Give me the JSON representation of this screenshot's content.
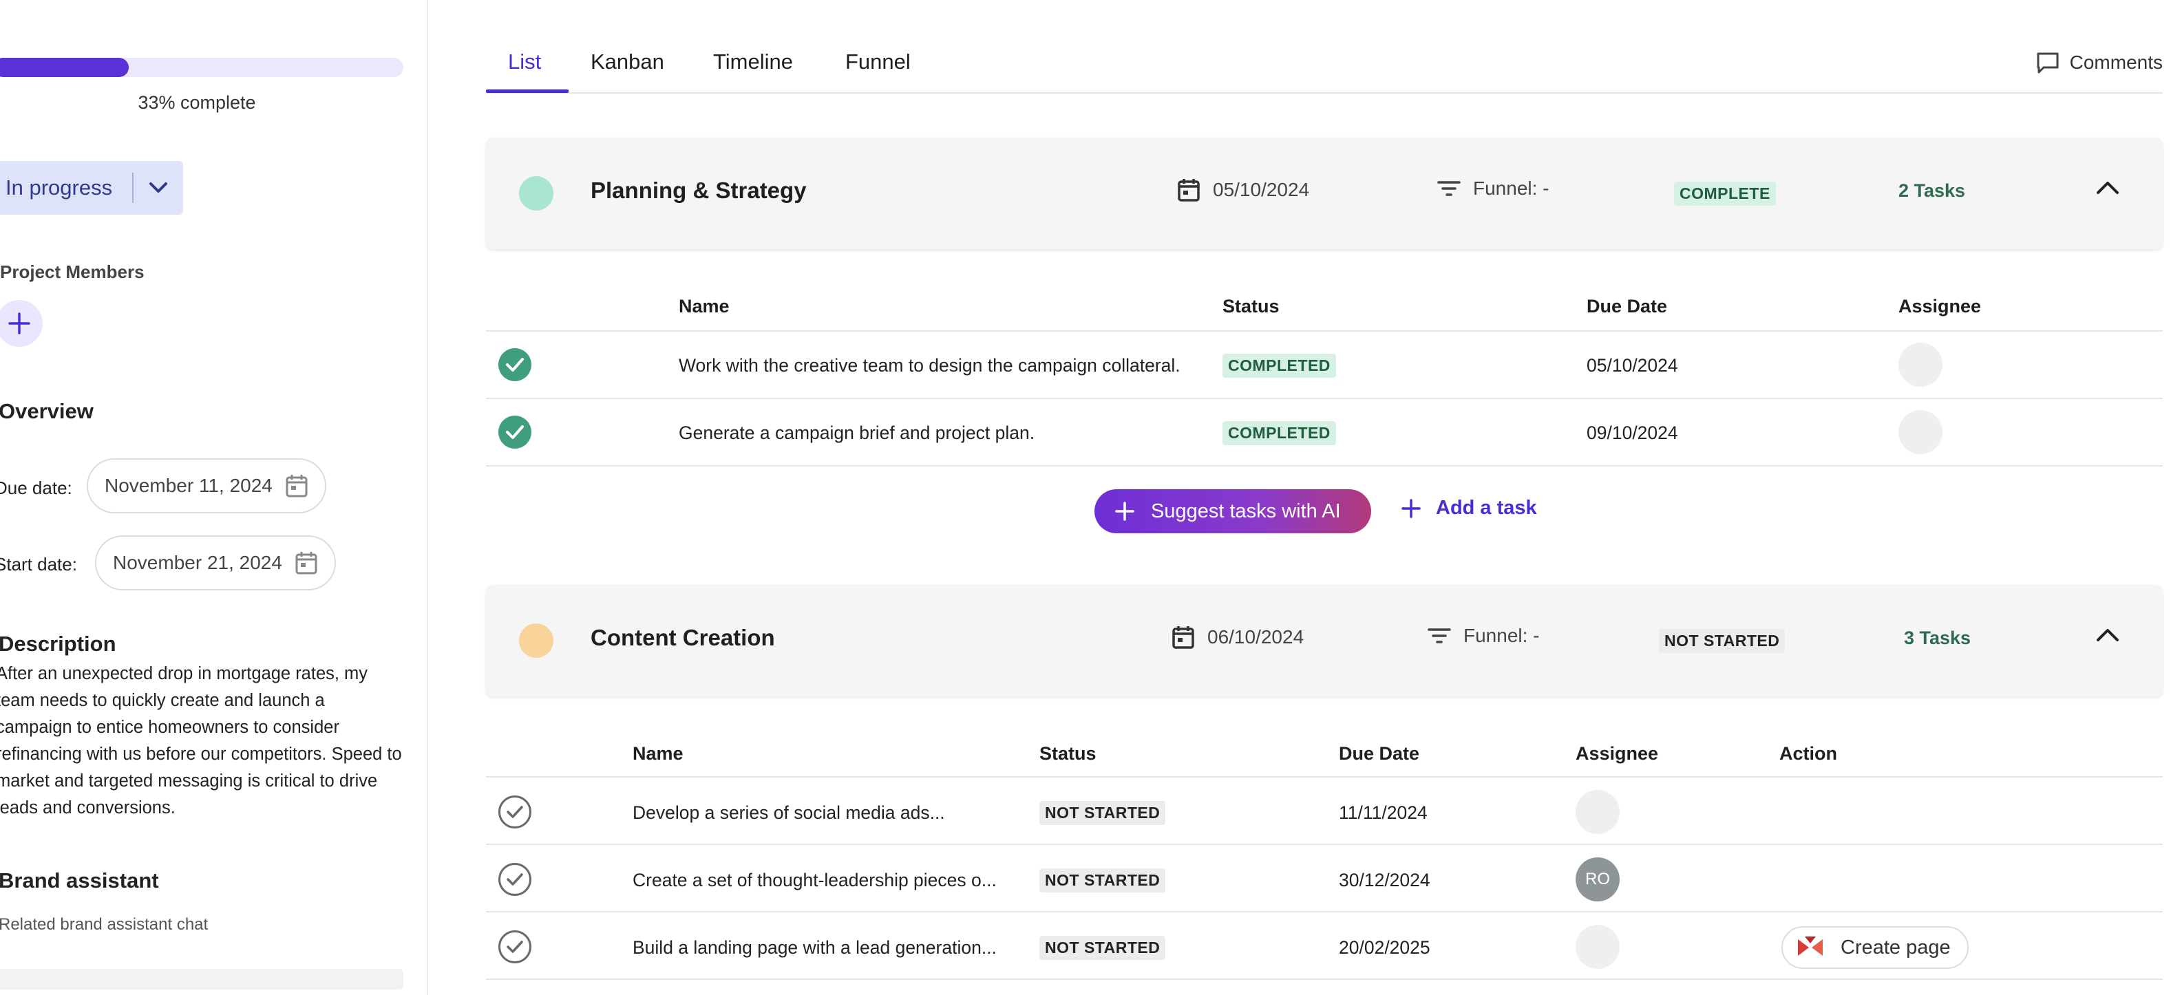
{
  "sidebar": {
    "progress": {
      "percent": 33,
      "label": "33% complete"
    },
    "status_dropdown": {
      "value": "In progress"
    },
    "members_label": "Project Members",
    "overview_heading": "Overview",
    "due_date": {
      "label": "Due date:",
      "value": "November 11, 2024"
    },
    "start_date": {
      "label": "Start date:",
      "value": "November 21, 2024"
    },
    "description_heading": "Description",
    "description_text": "After an unexpected drop in mortgage rates, my team needs to quickly create and launch a campaign to entice homeowners to consider refinancing with us before our competitors. Speed to market and targeted messaging is critical to drive leads and conversions.",
    "brand_heading": "Brand assistant",
    "brand_sub": "Related brand assistant chat"
  },
  "tabs": {
    "items": [
      {
        "label": "List",
        "active": true
      },
      {
        "label": "Kanban",
        "active": false
      },
      {
        "label": "Timeline",
        "active": false
      },
      {
        "label": "Funnel",
        "active": false
      }
    ],
    "comments_label": "Comments"
  },
  "sections": [
    {
      "title": "Planning & Strategy",
      "dot_color": "#a8e6cf",
      "date": "05/10/2024",
      "funnel": "Funnel: -",
      "status": "COMPLETE",
      "task_count": "2 Tasks",
      "columns": [
        "Name",
        "Status",
        "Due Date",
        "Assignee"
      ],
      "tasks": [
        {
          "name": "Work with the creative team to design the campaign collateral.",
          "status": "COMPLETED",
          "due": "05/10/2024",
          "assignee": ""
        },
        {
          "name": "Generate a campaign brief and project plan.",
          "status": "COMPLETED",
          "due": "09/10/2024",
          "assignee": ""
        }
      ],
      "ai_button": "Suggest tasks with AI",
      "add_task": "Add a task"
    },
    {
      "title": "Content Creation",
      "dot_color": "#f8d49a",
      "date": "06/10/2024",
      "funnel": "Funnel: -",
      "status": "NOT STARTED",
      "task_count": "3 Tasks",
      "columns": [
        "Name",
        "Status",
        "Due Date",
        "Assignee",
        "Action"
      ],
      "tasks": [
        {
          "name": "Develop a series of social media ads...",
          "status": "NOT STARTED",
          "due": "11/11/2024",
          "assignee": ""
        },
        {
          "name": "Create a set of thought-leadership pieces o...",
          "status": "NOT STARTED",
          "due": "30/12/2024",
          "assignee": "RO"
        },
        {
          "name": "Build a landing page with a lead generation...",
          "status": "NOT STARTED",
          "due": "20/02/2025",
          "assignee": "",
          "action": "Create page"
        }
      ]
    }
  ],
  "colors": {
    "accent": "#4a2bd4",
    "progress_fill": "#5a31d6",
    "complete_green": "#3f9d80"
  },
  "icons": {
    "calendar": "calendar-icon",
    "funnel": "filter-icon",
    "collapse": "chevron-up-icon",
    "comments": "comment-icon",
    "check": "check-circle-icon",
    "plus": "plus-icon"
  }
}
